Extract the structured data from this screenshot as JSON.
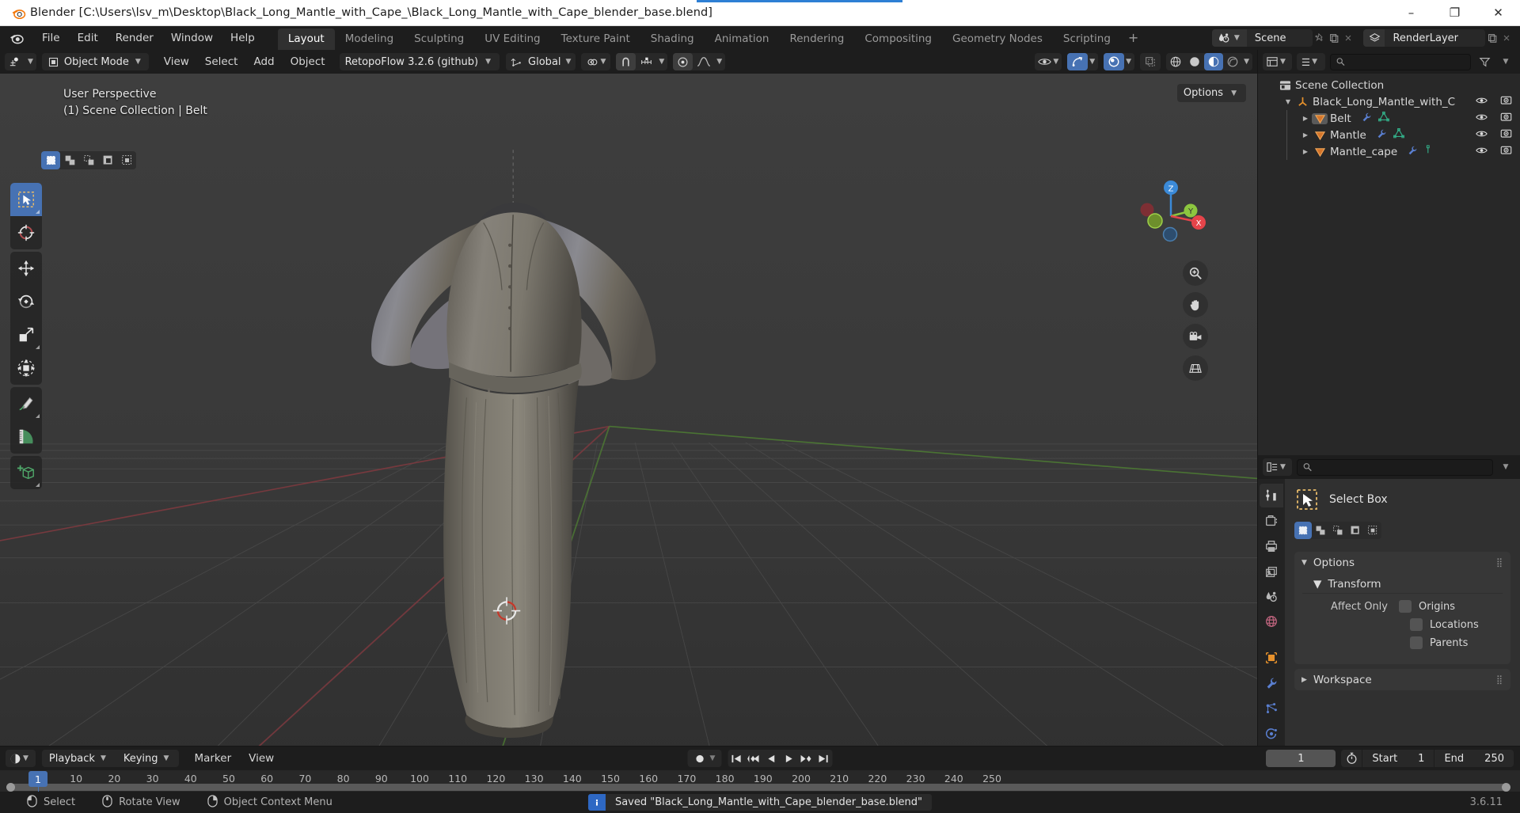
{
  "window": {
    "title": "Blender [C:\\Users\\lsv_m\\Desktop\\Black_Long_Mantle_with_Cape_\\Black_Long_Mantle_with_Cape_blender_base.blend]",
    "minimize": "–",
    "maximize": "❐",
    "close": "✕"
  },
  "topbar": {
    "menus": [
      "File",
      "Edit",
      "Render",
      "Window",
      "Help"
    ],
    "workspaces": [
      {
        "label": "Layout",
        "active": true
      },
      {
        "label": "Modeling",
        "active": false
      },
      {
        "label": "Sculpting",
        "active": false
      },
      {
        "label": "UV Editing",
        "active": false
      },
      {
        "label": "Texture Paint",
        "active": false
      },
      {
        "label": "Shading",
        "active": false
      },
      {
        "label": "Animation",
        "active": false
      },
      {
        "label": "Rendering",
        "active": false
      },
      {
        "label": "Compositing",
        "active": false
      },
      {
        "label": "Geometry Nodes",
        "active": false
      },
      {
        "label": "Scripting",
        "active": false
      }
    ],
    "add_workspace": "+",
    "scene_name": "Scene",
    "view_layer_name": "RenderLayer"
  },
  "viewport_header": {
    "mode": "Object Mode",
    "menus": [
      "View",
      "Select",
      "Add",
      "Object"
    ],
    "addon": "RetopoFlow 3.2.6 (github)",
    "transform_orientation": "Global"
  },
  "viewport": {
    "overlay_line1": "User Perspective",
    "overlay_line2": "(1) Scene Collection | Belt",
    "options_label": "Options",
    "gizmo_axes": [
      "Z",
      "Y",
      "X"
    ],
    "nav_icons": [
      "zoom-icon",
      "hand-icon",
      "camera-icon",
      "grid-icon"
    ],
    "toolbar_tools": [
      "select-box-tool",
      "cursor-tool",
      "move-tool",
      "rotate-tool",
      "scale-tool",
      "transform-tool",
      "annotate-tool",
      "measure-tool",
      "add-cube-tool"
    ]
  },
  "outliner": {
    "search_placeholder": "",
    "rows": [
      {
        "label": "Scene Collection",
        "icon": "collection-icon",
        "depth": 0,
        "expanded": true,
        "has_tri": false,
        "selected": false,
        "mods": []
      },
      {
        "label": "Black_Long_Mantle_with_C",
        "icon": "empty-axis-icon",
        "depth": 1,
        "expanded": true,
        "has_tri": true,
        "selected": false,
        "mods": []
      },
      {
        "label": "Belt",
        "icon": "mesh-icon",
        "depth": 2,
        "expanded": false,
        "has_tri": true,
        "selected": true,
        "mods": [
          "wrench-icon",
          "mesh-data-icon"
        ]
      },
      {
        "label": "Mantle",
        "icon": "mesh-icon",
        "depth": 2,
        "expanded": false,
        "has_tri": true,
        "selected": false,
        "mods": [
          "wrench-icon",
          "mesh-data-icon"
        ]
      },
      {
        "label": "Mantle_cape",
        "icon": "mesh-icon",
        "depth": 2,
        "expanded": false,
        "has_tri": true,
        "selected": false,
        "mods": [
          "wrench-icon",
          "vertex-data-icon"
        ]
      }
    ]
  },
  "properties": {
    "search_placeholder": "",
    "tabs": [
      {
        "name": "tool-tab",
        "icon": "tool-icon",
        "active": true
      },
      {
        "name": "render-tab",
        "icon": "render-icon",
        "active": false
      },
      {
        "name": "output-tab",
        "icon": "printer-icon",
        "active": false
      },
      {
        "name": "view-layer-tab",
        "icon": "images-icon",
        "active": false
      },
      {
        "name": "scene-tab",
        "icon": "scene-icon",
        "active": false
      },
      {
        "name": "world-tab",
        "icon": "world-icon",
        "active": false
      },
      {
        "name": "object-tab",
        "icon": "object-icon",
        "active": false
      },
      {
        "name": "modifier-tab",
        "icon": "wrench-icon",
        "active": false
      },
      {
        "name": "particles-tab",
        "icon": "particles-icon",
        "active": false
      },
      {
        "name": "physics-tab",
        "icon": "physics-icon",
        "active": false
      }
    ],
    "active_tool_name": "Select Box",
    "panels": {
      "options": "Options",
      "transform": "Transform",
      "affect_only_label": "Affect Only",
      "checkboxes": [
        {
          "label": "Origins",
          "checked": false
        },
        {
          "label": "Locations",
          "checked": false
        },
        {
          "label": "Parents",
          "checked": false
        }
      ],
      "workspace": "Workspace"
    }
  },
  "timeline": {
    "menus": [
      {
        "label": "Playback",
        "dropdown": true
      },
      {
        "label": "Keying",
        "dropdown": true
      },
      {
        "label": "View",
        "dropdown": false
      },
      {
        "label": "Marker",
        "dropdown": false
      }
    ],
    "current_frame": "1",
    "start_label": "Start",
    "start_value": "1",
    "end_label": "End",
    "end_value": "250",
    "playhead_frame": "1",
    "ticks": [
      "10",
      "20",
      "30",
      "40",
      "50",
      "60",
      "70",
      "80",
      "90",
      "100",
      "110",
      "120",
      "130",
      "140",
      "150",
      "160",
      "170",
      "180",
      "190",
      "200",
      "210",
      "220",
      "230",
      "240",
      "250"
    ]
  },
  "statusbar": {
    "items": [
      {
        "icon": "mouse-left-icon",
        "label": "Select"
      },
      {
        "icon": "mouse-middle-icon",
        "label": "Rotate View"
      },
      {
        "icon": "mouse-right-icon",
        "label": "Object Context Menu"
      }
    ],
    "report": "Saved \"Black_Long_Mantle_with_Cape_blender_base.blend\"",
    "report_icon": "info-icon",
    "version": "3.6.11"
  },
  "colors": {
    "accent_blue": "#4772b3",
    "orange": "#e8922c",
    "axis_x": "#e5444a",
    "axis_y": "#8cc63f",
    "axis_z": "#3b8ad8",
    "report_blue": "#2e68c4"
  }
}
